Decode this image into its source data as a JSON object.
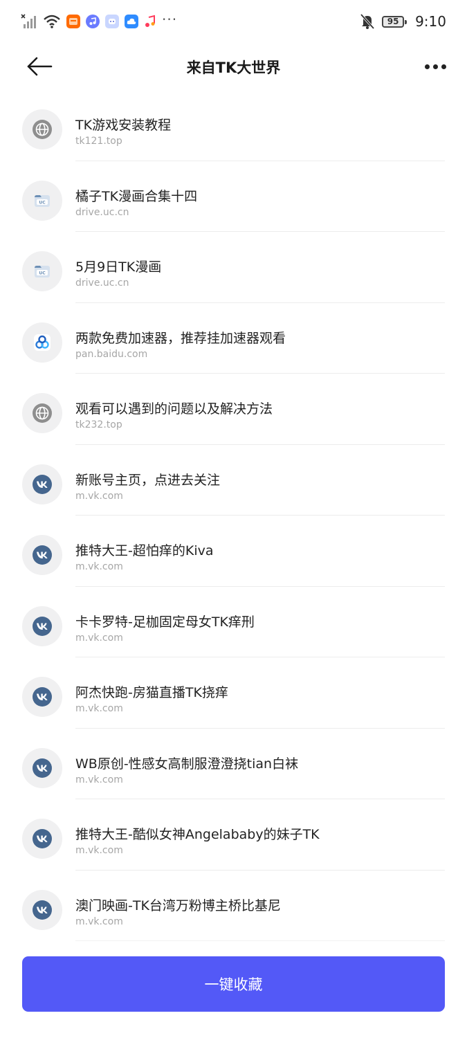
{
  "status_bar": {
    "time": "9:10",
    "battery": "95",
    "more": "···",
    "icons": [
      "signal-off-icon",
      "wifi-icon",
      "taobao-app-icon",
      "music-app-icon",
      "chat-bot-app-icon",
      "cloud-app-icon",
      "music-note-app-icon",
      "bell-off-icon",
      "battery-icon"
    ]
  },
  "header": {
    "title": "来自TK大世界",
    "back_icon": "arrow-left-icon",
    "more_icon": "more-dots-icon"
  },
  "links": [
    {
      "title": "TK游戏安装教程",
      "url": "tk121.top",
      "icon": "globe-icon"
    },
    {
      "title": "橘子TK漫画合集十四",
      "url": "drive.uc.cn",
      "icon": "uc-drive-icon"
    },
    {
      "title": "5月9日TK漫画",
      "url": "drive.uc.cn",
      "icon": "uc-drive-icon"
    },
    {
      "title": "两款免费加速器，推荐挂加速器观看",
      "url": "pan.baidu.com",
      "icon": "baidu-pan-icon"
    },
    {
      "title": "观看可以遇到的问题以及解决方法",
      "url": "tk232.top",
      "icon": "globe-icon"
    },
    {
      "title": "新账号主页，点进去关注",
      "url": "m.vk.com",
      "icon": "vk-icon"
    },
    {
      "title": "推特大王-超怕痒的Kiva",
      "url": "m.vk.com",
      "icon": "vk-icon"
    },
    {
      "title": "卡卡罗特-足枷固定母女TK痒刑",
      "url": "m.vk.com",
      "icon": "vk-icon"
    },
    {
      "title": "阿杰快跑-房猫直播TK挠痒",
      "url": "m.vk.com",
      "icon": "vk-icon"
    },
    {
      "title": "WB原创-性感女高制服澄澄挠tian白袜",
      "url": "m.vk.com",
      "icon": "vk-icon"
    },
    {
      "title": "推特大王-酷似女神Angelababy的妹子TK",
      "url": "m.vk.com",
      "icon": "vk-icon"
    },
    {
      "title": "澳门映画-TK台湾万粉博主桥比基尼",
      "url": "m.vk.com",
      "icon": "vk-icon"
    }
  ],
  "save_all_label": "一键收藏",
  "colors": {
    "accent": "#5359f7",
    "vk": "#45668e",
    "globe": "#8e8e8e",
    "uc": "#6c8fb5",
    "baidu": "#2a7bd9"
  }
}
